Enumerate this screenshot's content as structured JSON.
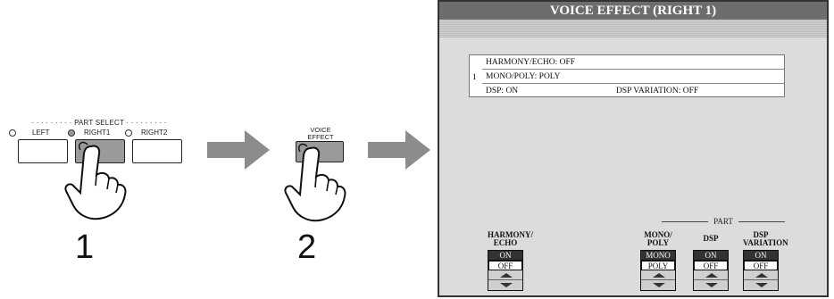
{
  "panel": {
    "part_select_label": "PART SELECT",
    "buttons": [
      {
        "label": "LEFT"
      },
      {
        "label": "RIGHT1"
      },
      {
        "label": "RIGHT2"
      }
    ],
    "voice_effect_label": "VOICE EFFECT",
    "steps": [
      "1",
      "2"
    ],
    "led_states": {
      "LEFT": "off",
      "RIGHT1": "on",
      "RIGHT2": "off"
    },
    "icons": [
      "hand-pointer-icon",
      "arrow-right-icon"
    ]
  },
  "screen": {
    "title": "VOICE EFFECT (RIGHT 1)",
    "part_index": "1",
    "rows": {
      "harmony": "HARMONY/ECHO: OFF",
      "mono_poly": "MONO/POLY: POLY",
      "dsp": "DSP: ON",
      "dsp_variation": "DSP VARIATION: OFF"
    },
    "part_caption": "PART",
    "controls": [
      {
        "label_line1": "HARMONY/",
        "label_line2": "ECHO",
        "options": [
          "ON",
          "OFF"
        ],
        "selected": "OFF"
      },
      {
        "label_line1": "MONO/",
        "label_line2": "POLY",
        "options": [
          "MONO",
          "POLY"
        ],
        "selected": "POLY"
      },
      {
        "label_line1": "DSP",
        "label_line2": "",
        "options": [
          "ON",
          "OFF"
        ],
        "selected": "OFF"
      },
      {
        "label_line1": "DSP",
        "label_line2": "VARIATION",
        "options": [
          "ON",
          "OFF"
        ],
        "selected": "OFF"
      }
    ],
    "colors": {
      "title_bg": "#6d6d6d",
      "screen_bg": "#dcdcdc",
      "selected_option_bg": "#ffffff",
      "unselected_option_bg": "#333333"
    }
  }
}
